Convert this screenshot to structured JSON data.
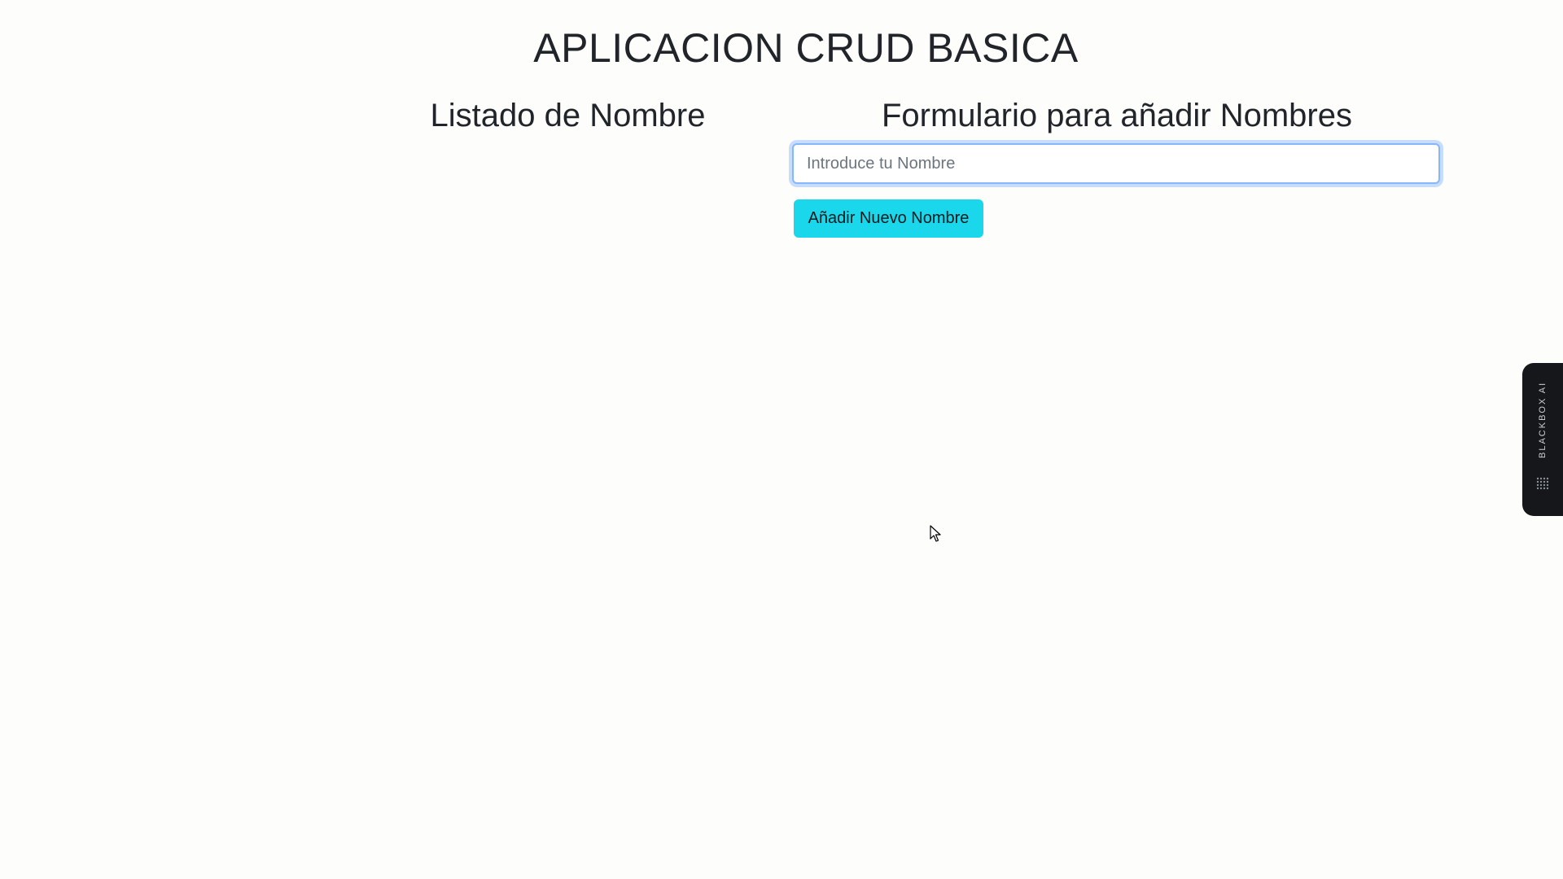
{
  "app": {
    "title": "APLICACION CRUD BASICA"
  },
  "list_section": {
    "heading": "Listado de Nombre"
  },
  "form_section": {
    "heading": "Formulario para añadir Nombres",
    "name_input": {
      "placeholder": "Introduce tu Nombre",
      "value": ""
    },
    "add_button_label": "Añadir Nuevo Nombre"
  },
  "side_widget": {
    "label": "BLACKBOX AI",
    "icon": "dot-grid-icon"
  },
  "cursor": {
    "icon": "mouse-pointer-icon"
  },
  "colors": {
    "background": "#fdfdfc",
    "text": "#212529",
    "button": "#1ad7ec",
    "input_focus": "#86b7fe",
    "widget": "#15171a"
  }
}
